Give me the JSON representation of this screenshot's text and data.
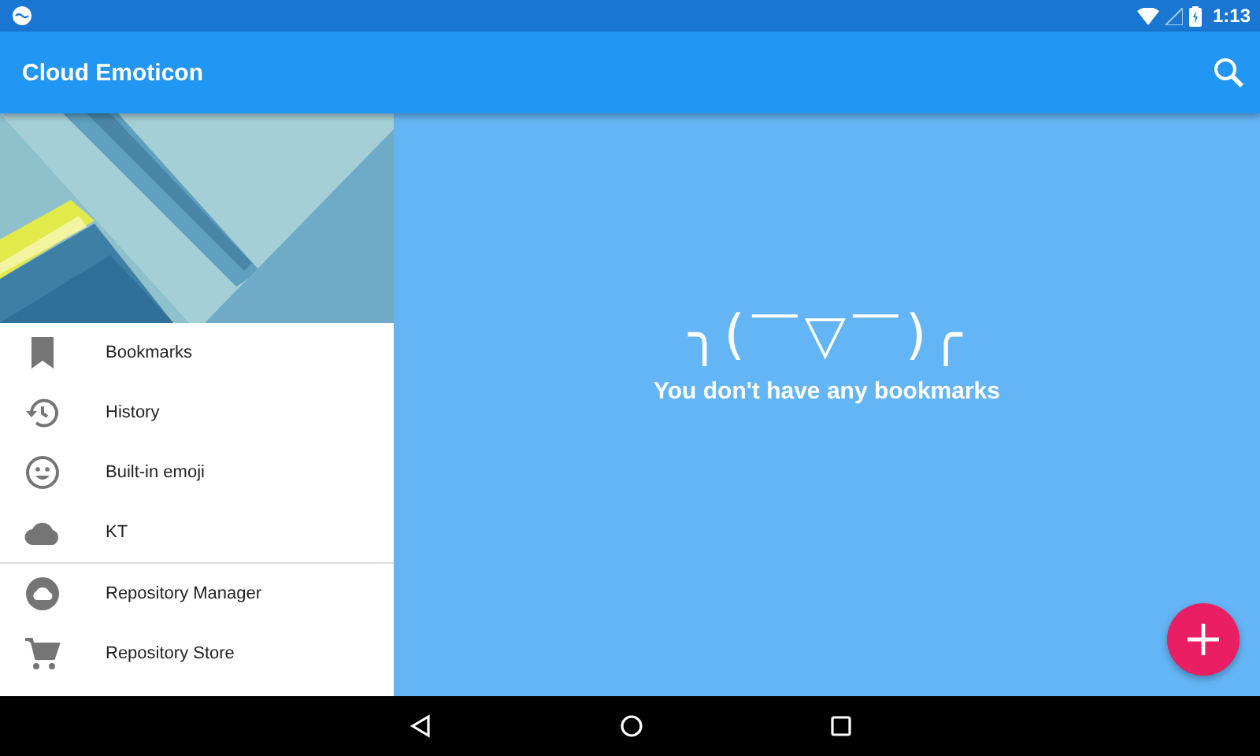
{
  "status_bar": {
    "time": "1:13"
  },
  "app_bar": {
    "title": "Cloud Emoticon"
  },
  "drawer": {
    "sections": [
      {
        "items": [
          {
            "label": "Bookmarks"
          },
          {
            "label": "History"
          },
          {
            "label": "Built-in emoji"
          },
          {
            "label": "KT"
          }
        ]
      },
      {
        "items": [
          {
            "label": "Repository Manager"
          },
          {
            "label": "Repository Store"
          }
        ]
      }
    ]
  },
  "empty_state": {
    "emoticon": "╮(￣▽￣)╭",
    "message": "You don't have any bookmarks"
  }
}
